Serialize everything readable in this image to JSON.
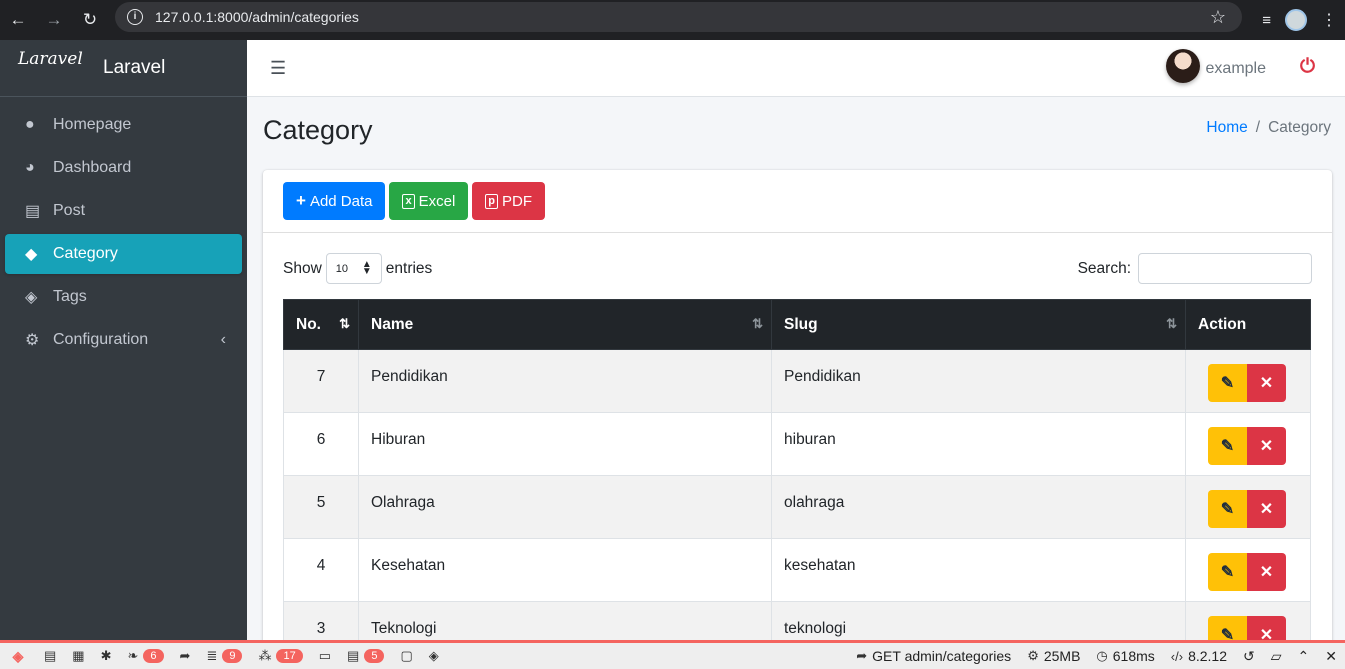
{
  "browser": {
    "url": "127.0.0.1:8000/admin/categories"
  },
  "brand": {
    "logo": "Laravel",
    "text": "Laravel"
  },
  "sidebar": {
    "items": [
      {
        "label": "Homepage",
        "icon": "globe-icon"
      },
      {
        "label": "Dashboard",
        "icon": "palette-icon"
      },
      {
        "label": "Post",
        "icon": "newspaper-icon"
      },
      {
        "label": "Category",
        "icon": "tag-icon",
        "active": true
      },
      {
        "label": "Tags",
        "icon": "tags-icon"
      },
      {
        "label": "Configuration",
        "icon": "cogs-icon"
      }
    ]
  },
  "topnav": {
    "user_name": "example"
  },
  "page": {
    "title": "Category",
    "breadcrumb": {
      "home": "Home",
      "current": "Category"
    }
  },
  "toolbar": {
    "add_label": "Add Data",
    "excel_label": "Excel",
    "pdf_label": "PDF"
  },
  "table_controls": {
    "show_label": "Show",
    "entries_value": "10",
    "entries_label": "entries",
    "search_label": "Search:"
  },
  "table": {
    "columns": [
      "No.",
      "Name",
      "Slug",
      "Action"
    ],
    "rows": [
      {
        "no": "7",
        "name": "Pendidikan",
        "slug": "Pendidikan"
      },
      {
        "no": "6",
        "name": "Hiburan",
        "slug": "hiburan"
      },
      {
        "no": "5",
        "name": "Olahraga",
        "slug": "olahraga"
      },
      {
        "no": "4",
        "name": "Kesehatan",
        "slug": "kesehatan"
      },
      {
        "no": "3",
        "name": "Teknologi",
        "slug": "teknologi"
      }
    ]
  },
  "debugbar": {
    "badges": [
      "6",
      "9",
      "17",
      "5"
    ],
    "request": "GET admin/categories",
    "memory": "25MB",
    "time": "618ms",
    "version": "8.2.12"
  },
  "colors": {
    "sidebar_bg": "#343a40",
    "active_item": "#17a2b8",
    "primary": "#007bff",
    "success": "#28a745",
    "danger": "#dc3545",
    "warning": "#ffc107"
  }
}
